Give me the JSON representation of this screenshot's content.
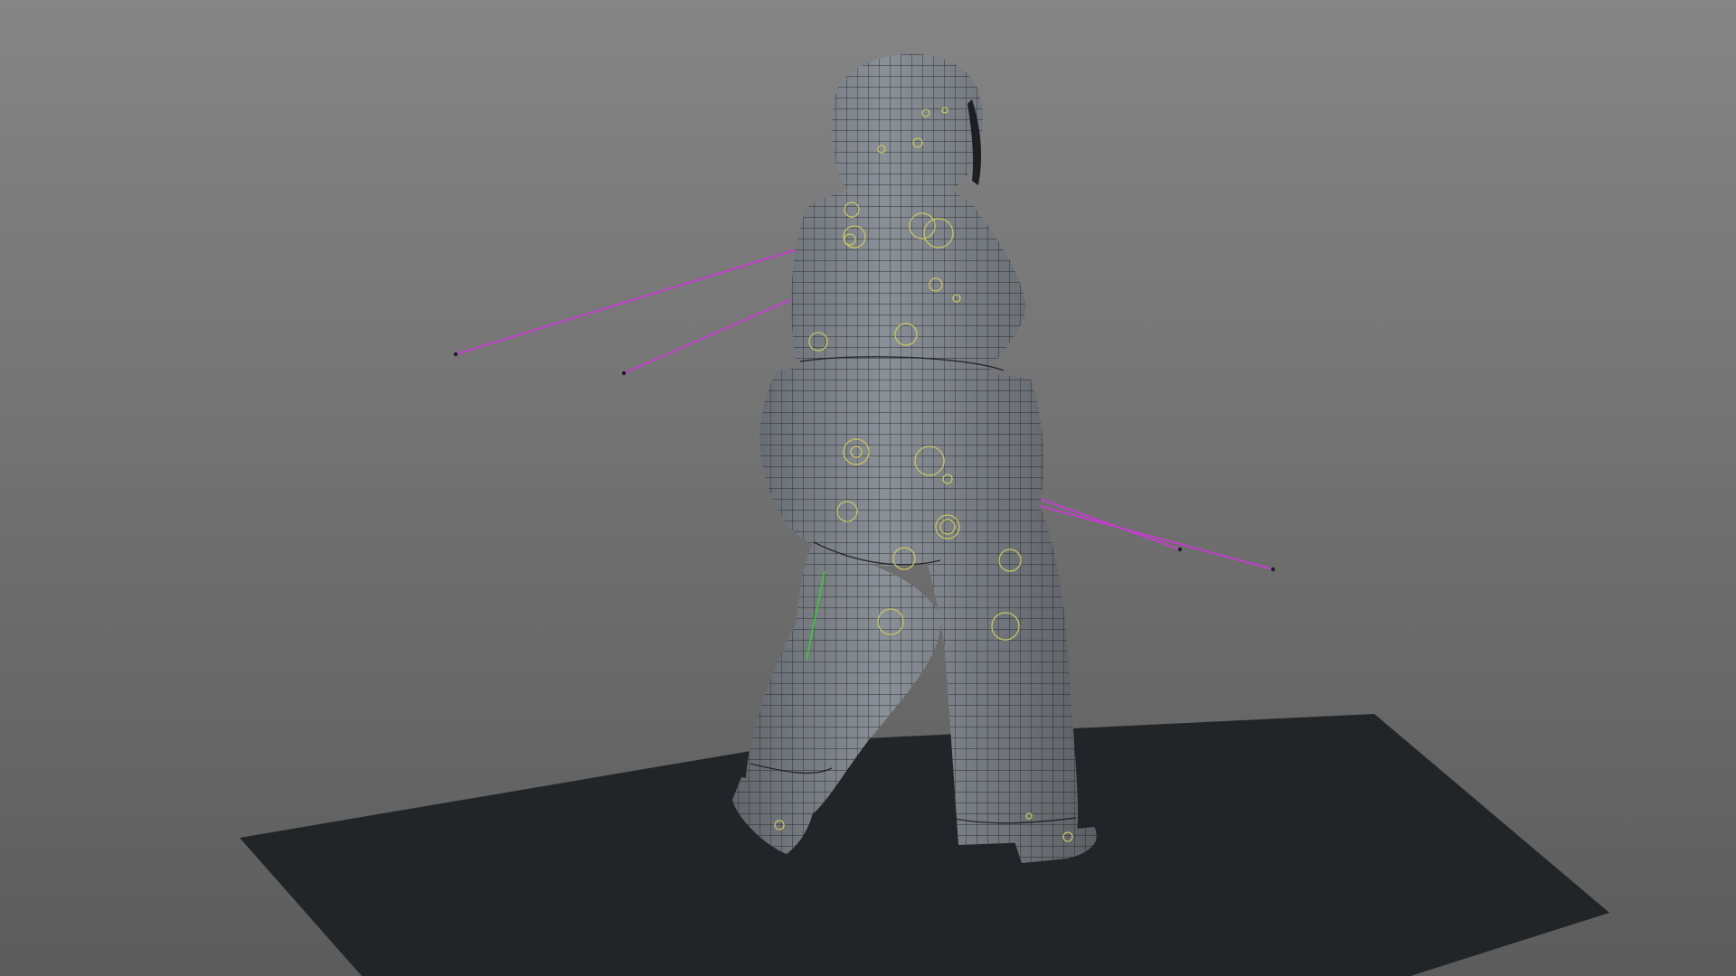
{
  "viewport": {
    "bg_top_color": "#858585",
    "bg_bottom_color": "#5c5c5c",
    "ground_color": "#222527",
    "mesh_fill_color": "#5a5e63",
    "mesh_highlight_color": "#8a9097",
    "wire_color": "#1d1f22",
    "rig_control_color": "#c9c460",
    "light_line_color": "#c040c8",
    "pole_vector_color": "#33cc33",
    "icons": {
      "ground_plane": "ground-plane",
      "character_mesh": "character-mesh",
      "rig_controls": "rig-control-circles",
      "lights": "light-direction-lines",
      "pole_vector": "pole-vector-line"
    }
  }
}
